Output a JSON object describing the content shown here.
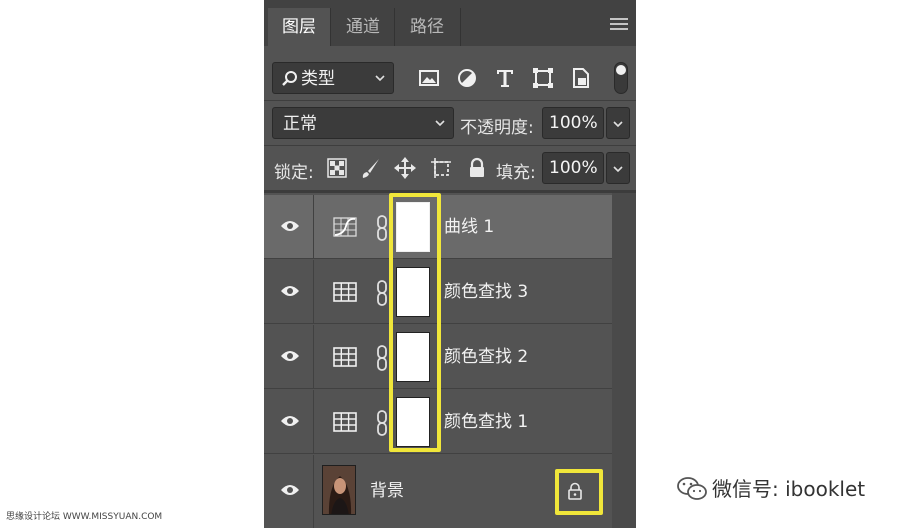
{
  "tabs": [
    {
      "label": "图层",
      "active": true
    },
    {
      "label": "通道",
      "active": false
    },
    {
      "label": "路径",
      "active": false
    }
  ],
  "filter": {
    "label": "类型",
    "icons": [
      "pixel-filter-icon",
      "adjustment-filter-icon",
      "type-filter-icon",
      "shape-filter-icon",
      "smart-object-filter-icon"
    ]
  },
  "blend": {
    "mode": "正常",
    "opacity_label": "不透明度:",
    "opacity_value": "100%"
  },
  "lock": {
    "label": "锁定:",
    "fill_label": "填充:",
    "fill_value": "100%"
  },
  "layers": [
    {
      "name": "曲线 1",
      "type": "curves",
      "selected": true
    },
    {
      "name": "颜色查找 3",
      "type": "color-lookup",
      "selected": false
    },
    {
      "name": "颜色查找 2",
      "type": "color-lookup",
      "selected": false
    },
    {
      "name": "颜色查找 1",
      "type": "color-lookup",
      "selected": false
    },
    {
      "name": "背景",
      "type": "background",
      "selected": false
    }
  ],
  "watermark": {
    "left": "思缘设计论坛 WWW.MISSYUAN.COM",
    "right": "微信号: ibooklet"
  },
  "colors": {
    "panel": "#535353",
    "highlight": "#f0e63a",
    "selected_row": "#6a6a6a"
  }
}
